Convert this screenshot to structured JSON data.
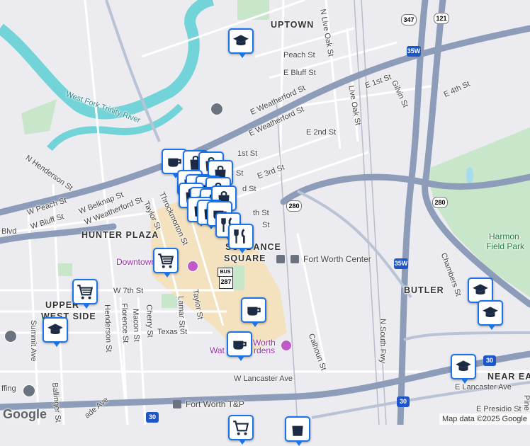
{
  "map": {
    "colors": {
      "land": "#ececf0",
      "river": "#72d4d8",
      "park": "#c8e6c9",
      "highway": "#8d9cb8",
      "road": "#ffffff",
      "downtown": "#f4e1bd",
      "pin_border": "#1a73e8",
      "pin_icon": "#1c2a44"
    },
    "districts": {
      "uptown": "UPTOWN",
      "hunter_plaza": "HUNTER PLAZA",
      "sundance_line1": "SUNDANCE",
      "sundance_line2": "SQUARE",
      "upper_west_side_line1": "UPPER",
      "upper_west_side_line2": "WEST SIDE",
      "butler": "BUTLER",
      "near_east": "NEAR EA"
    },
    "streets": {
      "n_live_oak": "N Live Oak St",
      "live_oak": "Live Oak St",
      "peach": "Peach St",
      "e_bluff": "E Bluff St",
      "e_1st_a": "E 1st St",
      "e_1st_b": "1st St",
      "gilvin": "Gilvin St",
      "e_4th": "E 4th St",
      "e_weatherford_a": "E Weatherford St",
      "e_weatherford_b": "E Weatherford St",
      "e_2nd": "E 2nd St",
      "e_3rd": "E 3rd St",
      "third_short": "d St",
      "n_henderson": "N Henderson St",
      "belknap": "W Belknap St",
      "w_weatherford": "W Weatherford St",
      "w_peach": "W Peach St",
      "w_bluff": "W Bluff St",
      "blvd": "Blvd",
      "taylor": "Taylor St",
      "throckmorton": "Throckmorton St",
      "w_7th": "W 7th St",
      "summit": "Summit Ave",
      "henderson": "Henderson St",
      "florence": "Florence St",
      "macon": "Macon St",
      "cherry": "Cherry St",
      "lamar": "Lamar St",
      "taylor2": "Taylor St",
      "texas": "Texas St",
      "calhoun": "Calhoun St",
      "n_south_fwy": "N South Fwy",
      "chambers": "Chambers St",
      "w_lancaster": "W Lancaster Ave",
      "e_lancaster": "E Lancaster Ave",
      "e_presidio": "E Presidio St",
      "ballinger": "Ballinger St",
      "ade_ave": "ade Ave",
      "pine": "Pine",
      "th_st": "th St",
      "st_tail": "St",
      "st_tail2": "St"
    },
    "river_label": "West Fork Trinity River",
    "places": {
      "fort_worth_center": "Fort Worth Center",
      "fort_worth_tp": "Fort Worth T&P",
      "downtown": "Downtown",
      "worth_mid": "Worth",
      "wat_gardens_a": "Wat",
      "wat_gardens_b": "rdens",
      "harmon_1": "Harmon",
      "harmon_2": "Field Park",
      "ffing": "ffing"
    },
    "shields": {
      "us287": "287",
      "bus": "BUS",
      "r280_a": "280",
      "r280_b": "280",
      "i35w_a": "35W",
      "i35w_b": "35W",
      "i30_a": "30",
      "i30_b": "30",
      "i30_c": "30",
      "r347": "347",
      "r121": "121"
    },
    "attribution": "Map data ©2025 Google",
    "logo": "Google"
  }
}
